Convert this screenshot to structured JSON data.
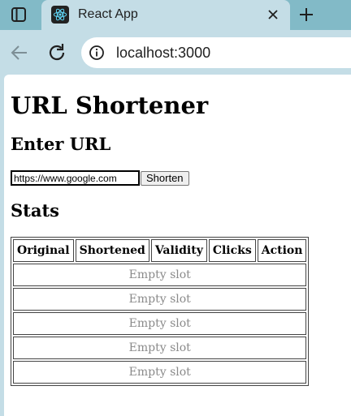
{
  "browser": {
    "tab_title": "React App",
    "url": "localhost:3000",
    "icons": {
      "tab_toggle": "sidebar-icon",
      "favicon": "react-icon",
      "close": "close-icon",
      "new_tab": "plus-icon",
      "back": "arrow-left-icon",
      "reload": "reload-icon",
      "site_info": "info-icon"
    }
  },
  "page": {
    "title": "URL Shortener",
    "enter_heading": "Enter URL",
    "url_input_value": "https://www.google.com",
    "shorten_label": "Shorten",
    "stats_heading": "Stats",
    "table": {
      "columns": [
        "Original",
        "Shortened",
        "Validity",
        "Clicks",
        "Action"
      ],
      "rows": [
        "Empty slot",
        "Empty slot",
        "Empty slot",
        "Empty slot",
        "Empty slot"
      ]
    }
  },
  "colors": {
    "tabbar": "#82bac7",
    "toolbar": "#c4dde6",
    "empty_text": "#8a8a8a"
  }
}
